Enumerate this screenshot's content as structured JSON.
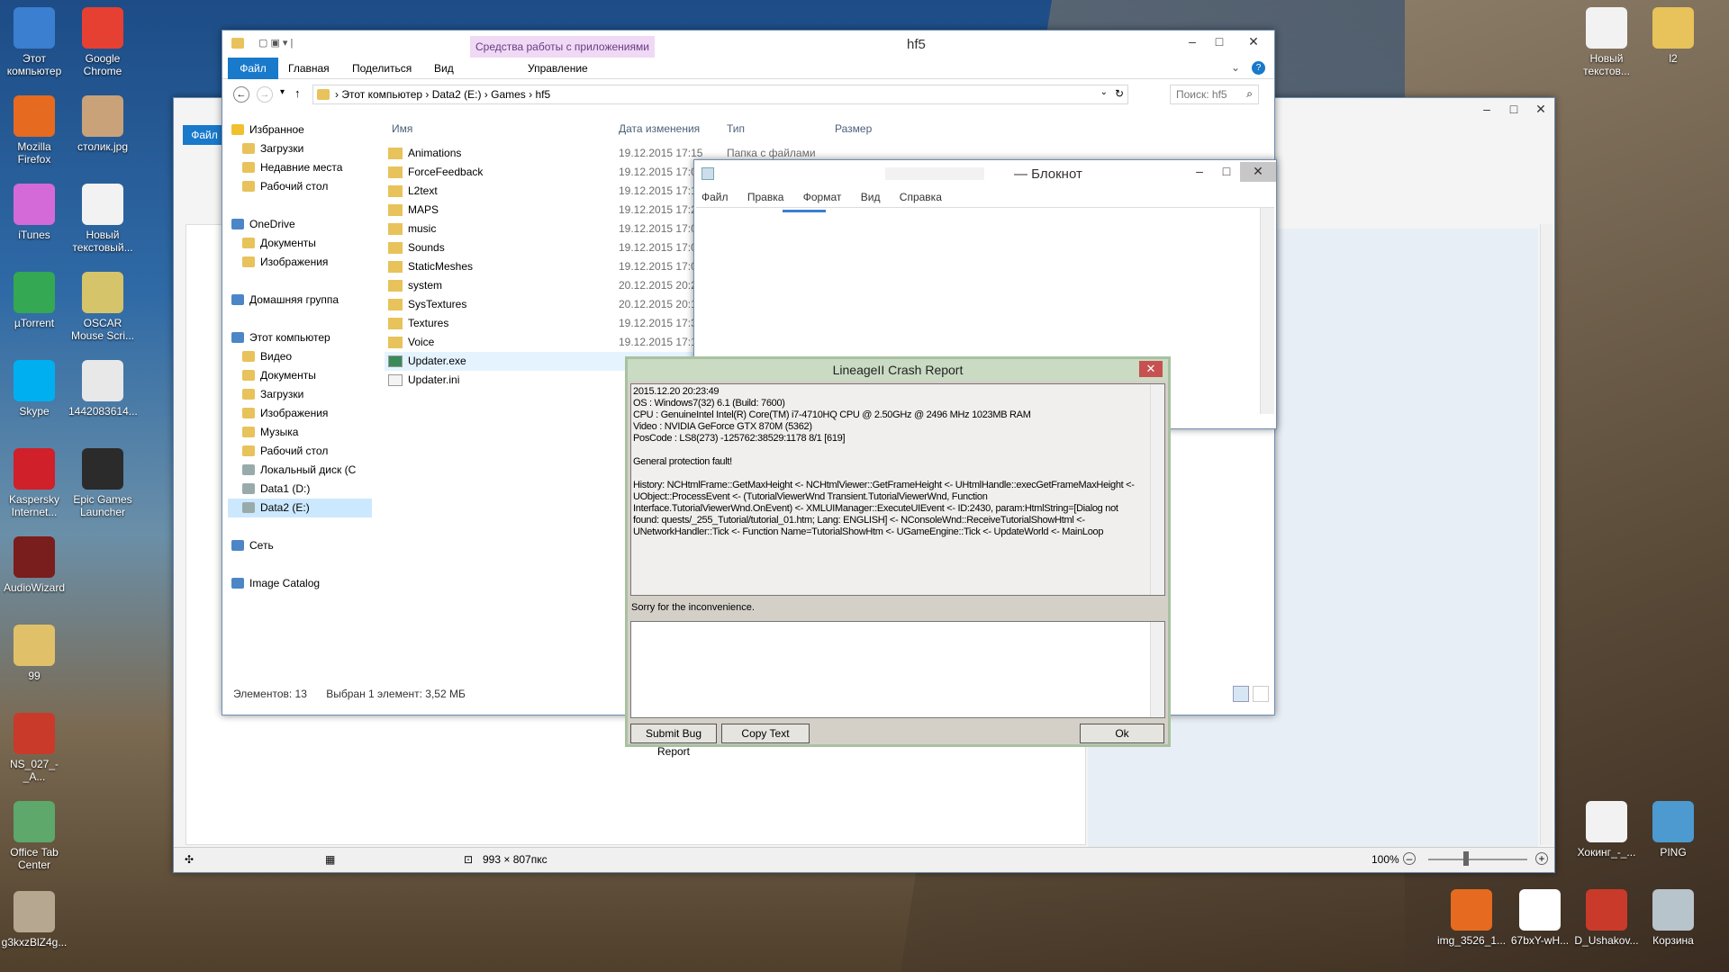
{
  "desktop": {
    "left_icons": [
      {
        "label": "Этот компьютер",
        "color": "#3a7fd0"
      },
      {
        "label": "Google Chrome",
        "color": "#e64033"
      },
      {
        "label": "Mozilla Firefox",
        "color": "#e66a1f"
      },
      {
        "label": "столик.jpg",
        "color": "#c9a27a"
      },
      {
        "label": "iTunes",
        "color": "#d46ad8"
      },
      {
        "label": "Новый текстовый...",
        "color": "#f2f2f2"
      },
      {
        "label": "µTorrent",
        "color": "#34a853"
      },
      {
        "label": "OSCAR Mouse Scri...",
        "color": "#d6c46a"
      },
      {
        "label": "Skype",
        "color": "#00aff0"
      },
      {
        "label": "1442083614...",
        "color": "#e8e8e8"
      },
      {
        "label": "Kaspersky Internet...",
        "color": "#d0202a"
      },
      {
        "label": "Epic Games Launcher",
        "color": "#2b2b2b"
      },
      {
        "label": "AudioWizard",
        "color": "#7a1d1d"
      },
      {
        "label": "99",
        "color": "#e0c16a"
      },
      {
        "label": "NS_027_-_A...",
        "color": "#c93a2a"
      },
      {
        "label": "Office Tab Center",
        "color": "#5da86a"
      },
      {
        "label": "g3kxzBlZ4g...",
        "color": "#b6a890"
      }
    ],
    "right_icons": [
      {
        "label": "Новый текстов...",
        "color": "#f2f2f2"
      },
      {
        "label": "l2",
        "color": "#e8c25a"
      },
      {
        "label": "Хокинг_-_...",
        "color": "#f2f2f2"
      },
      {
        "label": "PING",
        "color": "#4c9ad0"
      },
      {
        "label": "img_3526_1...",
        "color": "#e66a1f"
      },
      {
        "label": "67bxY-wH...",
        "color": "#ffffff"
      },
      {
        "label": "D_Ushakov...",
        "color": "#c93a2a"
      },
      {
        "label": "Корзина",
        "color": "#b8c4cc"
      }
    ]
  },
  "explorer": {
    "title": "hf5",
    "context_tab_group": "Средства работы с приложениями",
    "ribbon_tabs": [
      "Файл",
      "Главная",
      "Поделиться",
      "Вид",
      "Управление"
    ],
    "breadcrumb": [
      "Этот компьютер",
      "Data2 (E:)",
      "Games",
      "hf5"
    ],
    "search_placeholder": "Поиск: hf5",
    "nav": [
      {
        "label": "Избранное",
        "icon": "star-icon",
        "indent": 0
      },
      {
        "label": "Загрузки",
        "icon": "folder-icon",
        "indent": 1
      },
      {
        "label": "Недавние места",
        "icon": "folder-icon",
        "indent": 1
      },
      {
        "label": "Рабочий стол",
        "icon": "folder-icon",
        "indent": 1
      },
      {
        "label": "",
        "icon": "",
        "indent": 0
      },
      {
        "label": "OneDrive",
        "icon": "cloud-icon",
        "indent": 0
      },
      {
        "label": "Документы",
        "icon": "folder-icon",
        "indent": 1
      },
      {
        "label": "Изображения",
        "icon": "folder-icon",
        "indent": 1
      },
      {
        "label": "",
        "icon": "",
        "indent": 0
      },
      {
        "label": "Домашняя группа",
        "icon": "homegroup-icon",
        "indent": 0
      },
      {
        "label": "",
        "icon": "",
        "indent": 0
      },
      {
        "label": "Этот компьютер",
        "icon": "computer-icon",
        "indent": 0
      },
      {
        "label": "Видео",
        "icon": "folder-icon",
        "indent": 1
      },
      {
        "label": "Документы",
        "icon": "folder-icon",
        "indent": 1
      },
      {
        "label": "Загрузки",
        "icon": "folder-icon",
        "indent": 1
      },
      {
        "label": "Изображения",
        "icon": "folder-icon",
        "indent": 1
      },
      {
        "label": "Музыка",
        "icon": "folder-icon",
        "indent": 1
      },
      {
        "label": "Рабочий стол",
        "icon": "folder-icon",
        "indent": 1
      },
      {
        "label": "Локальный диск (C",
        "icon": "drive-icon",
        "indent": 1
      },
      {
        "label": "Data1 (D:)",
        "icon": "drive-icon",
        "indent": 1
      },
      {
        "label": "Data2 (E:)",
        "icon": "drive-icon",
        "indent": 1,
        "selected": true
      },
      {
        "label": "",
        "icon": "",
        "indent": 0
      },
      {
        "label": "Сеть",
        "icon": "network-icon",
        "indent": 0
      },
      {
        "label": "",
        "icon": "",
        "indent": 0
      },
      {
        "label": "Image Catalog",
        "icon": "catalog-icon",
        "indent": 0
      }
    ],
    "columns": [
      "Имя",
      "Дата изменения",
      "Тип",
      "Размер"
    ],
    "files": [
      {
        "name": "Animations",
        "date": "19.12.2015 17:15",
        "type": "Папка с файлами",
        "kind": "folder"
      },
      {
        "name": "ForceFeedback",
        "date": "19.12.2015 17:0",
        "type": "",
        "kind": "folder"
      },
      {
        "name": "L2text",
        "date": "19.12.2015 17:1",
        "type": "",
        "kind": "folder"
      },
      {
        "name": "MAPS",
        "date": "19.12.2015 17:2",
        "type": "",
        "kind": "folder"
      },
      {
        "name": "music",
        "date": "19.12.2015 17:0",
        "type": "",
        "kind": "folder"
      },
      {
        "name": "Sounds",
        "date": "19.12.2015 17:0",
        "type": "",
        "kind": "folder"
      },
      {
        "name": "StaticMeshes",
        "date": "19.12.2015 17:0",
        "type": "",
        "kind": "folder"
      },
      {
        "name": "system",
        "date": "20.12.2015 20:2",
        "type": "",
        "kind": "folder"
      },
      {
        "name": "SysTextures",
        "date": "20.12.2015 20:1",
        "type": "",
        "kind": "folder"
      },
      {
        "name": "Textures",
        "date": "19.12.2015 17:3",
        "type": "",
        "kind": "folder"
      },
      {
        "name": "Voice",
        "date": "19.12.2015 17:1",
        "type": "",
        "kind": "folder"
      },
      {
        "name": "Updater.exe",
        "date": "",
        "type": "",
        "kind": "exe",
        "selected": true
      },
      {
        "name": "Updater.ini",
        "date": "",
        "type": "",
        "kind": "ini"
      }
    ],
    "status_count": "Элементов: 13",
    "status_selected": "Выбран 1 элемент: 3,52 МБ"
  },
  "notepad": {
    "title": "— Блокнот",
    "menu": [
      "Файл",
      "Правка",
      "Формат",
      "Вид",
      "Справка"
    ]
  },
  "photo_viewer": {
    "tab_file": "Файл",
    "dimensions": "993 × 807пкс",
    "zoom": "100%"
  },
  "crash": {
    "title": "LineageII Crash Report",
    "report_lines": [
      "2015.12.20 20:23:49",
      "OS : Windows7(32) 6.1 (Build: 7600)",
      "CPU : GenuineIntel  Intel(R) Core(TM) i7-4710HQ CPU @ 2.50GHz @ 2496 MHz 1023MB RAM",
      "Video : NVIDIA GeForce GTX 870M (5362)",
      "PosCode : LS8(273) -125762:38529:1178 8/1 [619]",
      "",
      "General protection fault!",
      "",
      "History: NCHtmlFrame::GetMaxHeight <- NCHtmlViewer::GetFrameHeight <- UHtmlHandle::execGetFrameMaxHeight <- UObject::ProcessEvent <- (TutorialViewerWnd Transient.TutorialViewerWnd, Function Interface.TutorialViewerWnd.OnEvent) <- XMLUIManager::ExecuteUIEvent <- ID:2430, param:HtmlString=[Dialog not found: quests/_255_Tutorial/tutorial_01.htm; Lang: ENGLISH] <- NConsoleWnd::ReceiveTutorialShowHtml <- UNetworkHandler::Tick <- Function Name=TutorialShowHtm <- UGameEngine::Tick <- UpdateWorld <- MainLoop"
    ],
    "sorry": "Sorry for the inconvenience.",
    "submit_label": "Submit Bug Report",
    "copy_label": "Copy Text",
    "ok_label": "Ok"
  }
}
